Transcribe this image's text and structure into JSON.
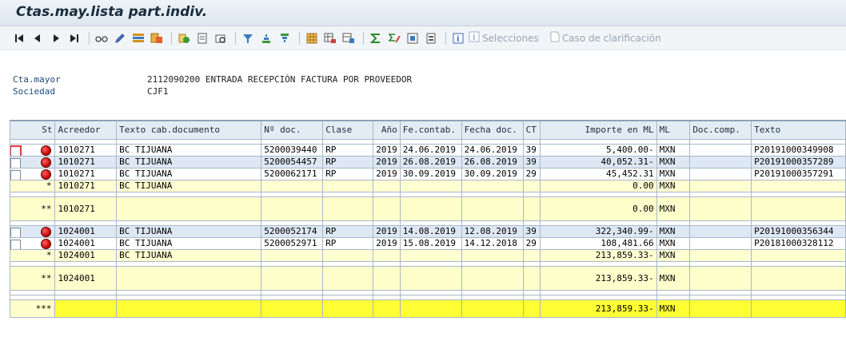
{
  "window": {
    "title": "Ctas.may.lista part.indiv."
  },
  "toolbar": {
    "selecciones_label": "Selecciones",
    "caso_label": "Caso de clarificación"
  },
  "header": {
    "cta_label": "Cta.mayor",
    "cta_value": "2112090200  ENTRADA RECEPCIÓN FACTURA POR PROVEEDOR",
    "sociedad_label": "Sociedad",
    "sociedad_value": "CJF1"
  },
  "table": {
    "columns": [
      "St",
      "Acreedor",
      "Texto cab.documento",
      "Nº doc.",
      "Clase",
      "Año",
      "Fe.contab.",
      "Fecha doc.",
      "CT",
      "Importe en ML",
      "ML",
      "Doc.comp.",
      "Texto"
    ],
    "rows": [
      {
        "type": "item",
        "acreedor": "1010271",
        "texto_cab": "BC TIJUANA",
        "ndoc": "5200039440",
        "clase": "RP",
        "anio": "2019",
        "fecontab": "24.06.2019",
        "fechadoc": "24.06.2019",
        "ct": "39",
        "importe": "5,400.00-",
        "ml": "MXN",
        "doccomp": "",
        "texto": "P20191000349908"
      },
      {
        "type": "item",
        "acreedor": "1010271",
        "texto_cab": "BC TIJUANA",
        "ndoc": "5200054457",
        "clase": "RP",
        "anio": "2019",
        "fecontab": "26.08.2019",
        "fechadoc": "26.08.2019",
        "ct": "39",
        "importe": "40,052.31-",
        "ml": "MXN",
        "doccomp": "",
        "texto": "P20191000357289"
      },
      {
        "type": "item",
        "acreedor": "1010271",
        "texto_cab": "BC TIJUANA",
        "ndoc": "5200062171",
        "clase": "RP",
        "anio": "2019",
        "fecontab": "30.09.2019",
        "fechadoc": "30.09.2019",
        "ct": "29",
        "importe": "45,452.31",
        "ml": "MXN",
        "doccomp": "",
        "texto": "P20191000357291"
      },
      {
        "type": "sub",
        "st": "*",
        "acreedor": "1010271",
        "texto_cab": "BC TIJUANA",
        "importe": "0.00",
        "ml": "MXN"
      },
      {
        "type": "tot",
        "st": "**",
        "acreedor": "1010271",
        "importe": "0.00",
        "ml": "MXN"
      },
      {
        "type": "item",
        "acreedor": "1024001",
        "texto_cab": "BC TIJUANA",
        "ndoc": "5200052174",
        "clase": "RP",
        "anio": "2019",
        "fecontab": "14.08.2019",
        "fechadoc": "12.08.2019",
        "ct": "39",
        "importe": "322,340.99-",
        "ml": "MXN",
        "doccomp": "",
        "texto": "P20191000356344"
      },
      {
        "type": "item",
        "acreedor": "1024001",
        "texto_cab": "BC TIJUANA",
        "ndoc": "5200052971",
        "clase": "RP",
        "anio": "2019",
        "fecontab": "15.08.2019",
        "fechadoc": "14.12.2018",
        "ct": "29",
        "importe": "108,481.66",
        "ml": "MXN",
        "doccomp": "",
        "texto": "P20181000328112"
      },
      {
        "type": "sub",
        "st": "*",
        "acreedor": "1024001",
        "texto_cab": "BC TIJUANA",
        "importe": "213,859.33-",
        "ml": "MXN"
      },
      {
        "type": "tot",
        "st": "**",
        "acreedor": "1024001",
        "importe": "213,859.33-",
        "ml": "MXN"
      },
      {
        "type": "grand",
        "st": "***",
        "importe": "213,859.33-",
        "ml": "MXN"
      }
    ]
  },
  "colors": {
    "status_open": "#d00000",
    "subtotal_bg": "#ffffd2",
    "grand_bg": "#ffff33",
    "stripe_bg": "#dde8f4"
  }
}
